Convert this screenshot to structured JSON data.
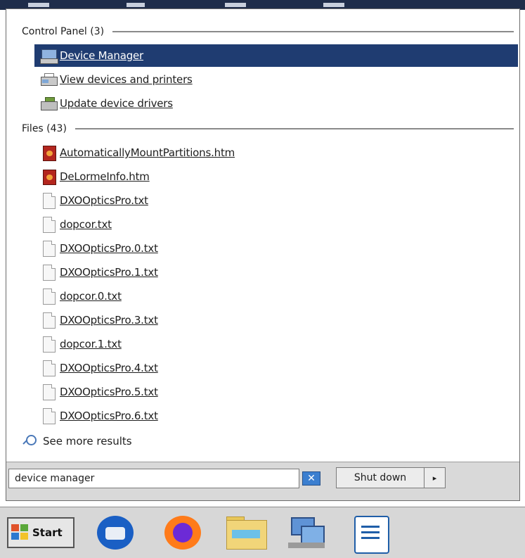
{
  "control_panel": {
    "header": "Control Panel (3)",
    "items": [
      {
        "label": "Device Manager",
        "icon": "device-manager-icon",
        "selected": true
      },
      {
        "label": "View devices and printers",
        "icon": "printer-icon",
        "selected": false
      },
      {
        "label": "Update device drivers",
        "icon": "update-driver-icon",
        "selected": false
      }
    ]
  },
  "files": {
    "header": "Files (43)",
    "items": [
      {
        "label": "AutomaticallyMountPartitions.htm",
        "icon": "htm-file-icon"
      },
      {
        "label": "DeLormeInfo.htm",
        "icon": "htm-file-icon"
      },
      {
        "label": "DXOOpticsPro.txt",
        "icon": "txt-file-icon"
      },
      {
        "label": "dopcor.txt",
        "icon": "txt-file-icon"
      },
      {
        "label": "DXOOpticsPro.0.txt",
        "icon": "txt-file-icon"
      },
      {
        "label": "DXOOpticsPro.1.txt",
        "icon": "txt-file-icon"
      },
      {
        "label": "dopcor.0.txt",
        "icon": "txt-file-icon"
      },
      {
        "label": "DXOOpticsPro.3.txt",
        "icon": "txt-file-icon"
      },
      {
        "label": "dopcor.1.txt",
        "icon": "txt-file-icon"
      },
      {
        "label": "DXOOpticsPro.4.txt",
        "icon": "txt-file-icon"
      },
      {
        "label": "DXOOpticsPro.5.txt",
        "icon": "txt-file-icon"
      },
      {
        "label": "DXOOpticsPro.6.txt",
        "icon": "txt-file-icon"
      }
    ]
  },
  "see_more": "See more results",
  "search": {
    "value": "device manager"
  },
  "shutdown": {
    "label": "Shut down",
    "arrow": "▸"
  },
  "clear_glyph": "✕",
  "taskbar": {
    "start_label": "Start",
    "apps": [
      "thunderbird-icon",
      "firefox-icon",
      "file-manager-icon",
      "network-icon",
      "writer-icon"
    ]
  },
  "colors": {
    "selection": "#1f3c71",
    "taskbar": "#d7d7d7"
  }
}
